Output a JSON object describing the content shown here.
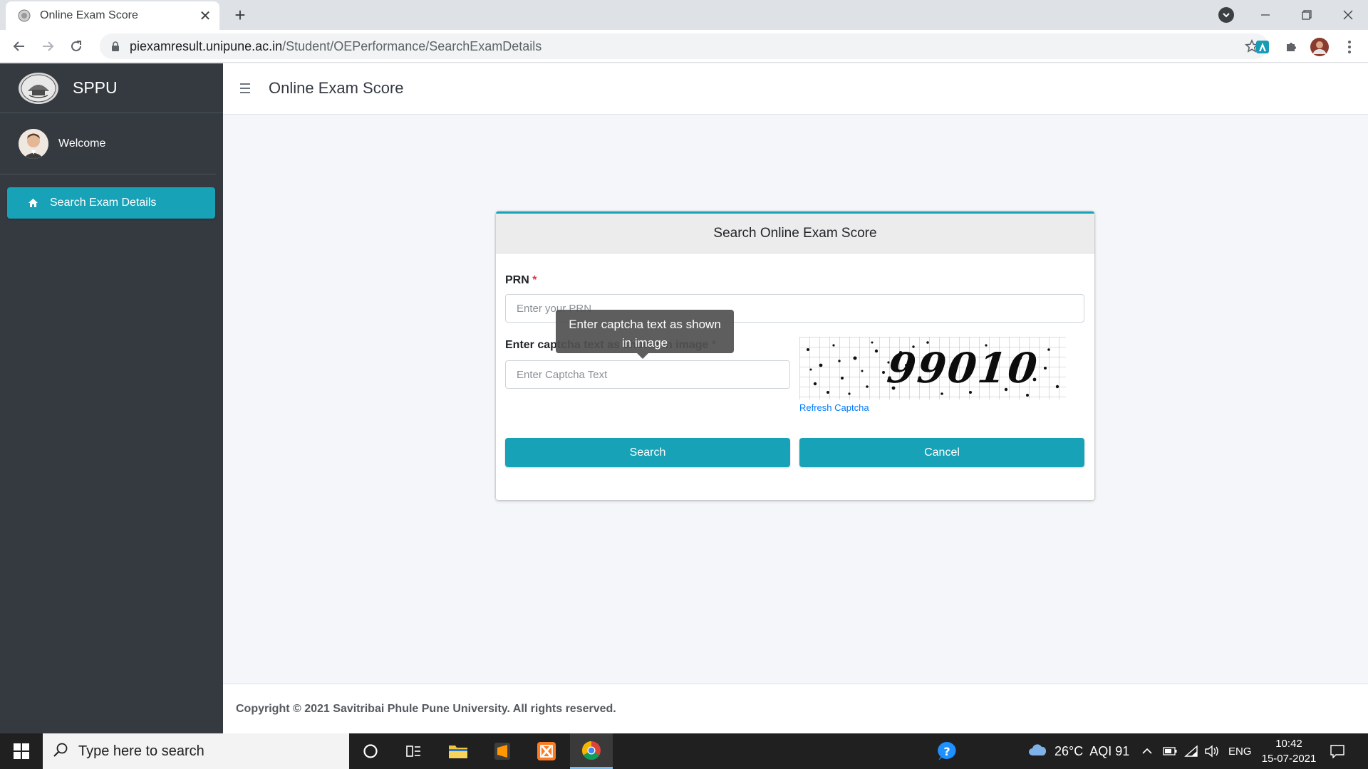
{
  "browser": {
    "tab_title": "Online Exam Score",
    "new_tab": "+",
    "url_domain": "piexamresult.unipune.ac.in",
    "url_path": "/Student/OEPerformance/SearchExamDetails"
  },
  "sidebar": {
    "brand": "SPPU",
    "welcome": "Welcome",
    "items": [
      {
        "label": "Search Exam Details",
        "icon": "home-icon"
      }
    ]
  },
  "header": {
    "title": "Online Exam Score"
  },
  "form": {
    "title": "Search Online Exam Score",
    "prn_label": "PRN",
    "required_mark": "*",
    "prn_placeholder": "Enter your PRN",
    "captcha_label": "Enter captcha text as shown in image",
    "captcha_placeholder": "Enter Captcha Text",
    "captcha_text": "99010",
    "refresh_label": "Refresh Captcha",
    "search_label": "Search",
    "cancel_label": "Cancel",
    "tooltip": "Enter captcha text as shown in image"
  },
  "footer": {
    "copyright": "Copyright © 2021 Savitribai Phule Pune University. All rights reserved."
  },
  "taskbar": {
    "search_placeholder": "Type here to search",
    "weather": "26°C  AQI 91",
    "lang": "ENG",
    "time": "10:42",
    "date": "15-07-2021"
  },
  "colors": {
    "accent": "#17a2b8",
    "sidebar": "#343a40",
    "required": "#dc3545",
    "link": "#007bff"
  }
}
